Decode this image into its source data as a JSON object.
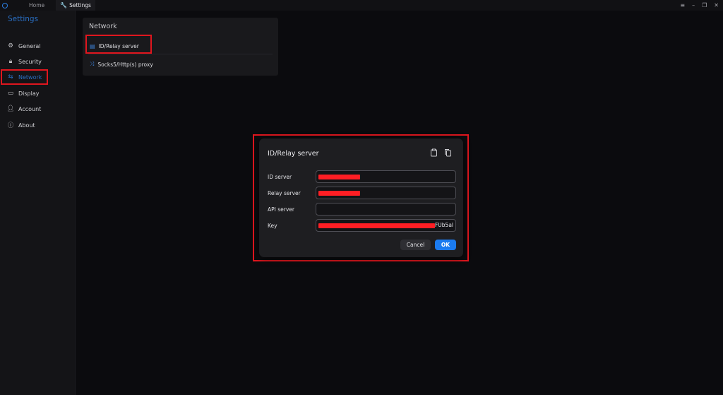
{
  "titlebar": {
    "tabs": [
      {
        "label": "Home",
        "active": false
      },
      {
        "label": "Settings",
        "active": true
      }
    ],
    "controls": {
      "menu": "≡",
      "minimize": "–",
      "restore": "❐",
      "close": "✕"
    }
  },
  "sidebar": {
    "title": "Settings",
    "items": [
      {
        "label": "General",
        "icon": "gear-icon",
        "active": false
      },
      {
        "label": "Security",
        "icon": "lock-icon",
        "active": false
      },
      {
        "label": "Network",
        "icon": "network-icon",
        "active": true
      },
      {
        "label": "Display",
        "icon": "monitor-icon",
        "active": false
      },
      {
        "label": "Account",
        "icon": "person-icon",
        "active": false
      },
      {
        "label": "About",
        "icon": "info-icon",
        "active": false
      }
    ]
  },
  "network_panel": {
    "title": "Network",
    "items": [
      {
        "label": "ID/Relay server",
        "icon": "server-icon"
      },
      {
        "label": "Socks5/Http(s) proxy",
        "icon": "proxy-icon"
      }
    ]
  },
  "dialog": {
    "title": "ID/Relay server",
    "fields": {
      "id_server": {
        "label": "ID server",
        "value": "",
        "redacted": true
      },
      "relay_server": {
        "label": "Relay server",
        "value": "",
        "redacted": true
      },
      "api_server": {
        "label": "API server",
        "value": ""
      },
      "key": {
        "label": "Key",
        "value_visible_tail": "FUb5al",
        "redacted": true
      }
    },
    "buttons": {
      "cancel": "Cancel",
      "ok": "OK"
    }
  },
  "colors": {
    "accent": "#1b7bf0",
    "sidebar_active": "#2a6fc4",
    "highlight_box": "#e0161e",
    "redaction": "#ff1e24"
  }
}
